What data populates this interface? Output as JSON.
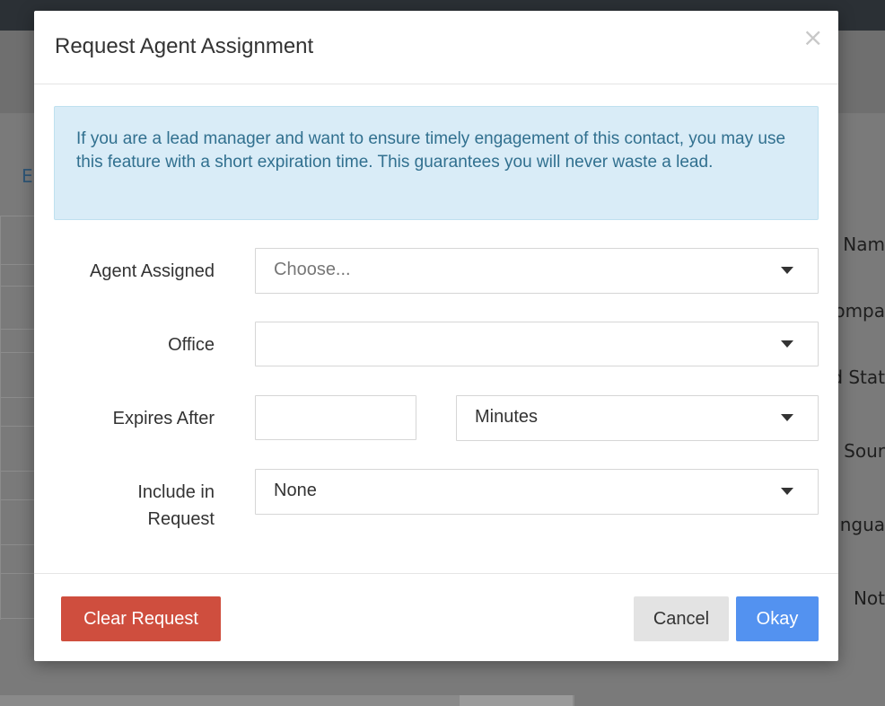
{
  "background": {
    "tab_label": "Er",
    "field_labels": [
      "st Nam",
      "ompa",
      "d Stat",
      "d Sour",
      "angua",
      "Not"
    ]
  },
  "modal": {
    "title": "Request Agent Assignment",
    "close_glyph": "×",
    "alert_text": "If you are a lead manager and want to ensure timely engagement of this contact, you may use this feature with a short expiration time. This guarantees you will never waste a lead.",
    "fields": {
      "agent_assigned": {
        "label": "Agent Assigned",
        "placeholder": "Choose..."
      },
      "office": {
        "label": "Office",
        "value": ""
      },
      "expires_after": {
        "label": "Expires After",
        "amount": "",
        "unit": "Minutes"
      },
      "include_in_request": {
        "label_line1": "Include in",
        "label_line2": "Request",
        "value": "None"
      }
    },
    "buttons": {
      "clear": "Clear Request",
      "cancel": "Cancel",
      "okay": "Okay"
    }
  },
  "colors": {
    "alert_bg": "#d9ecf7",
    "alert_text": "#31708f",
    "danger": "#cf4e3e",
    "primary": "#5392f0",
    "default_button": "#e3e3e3"
  }
}
